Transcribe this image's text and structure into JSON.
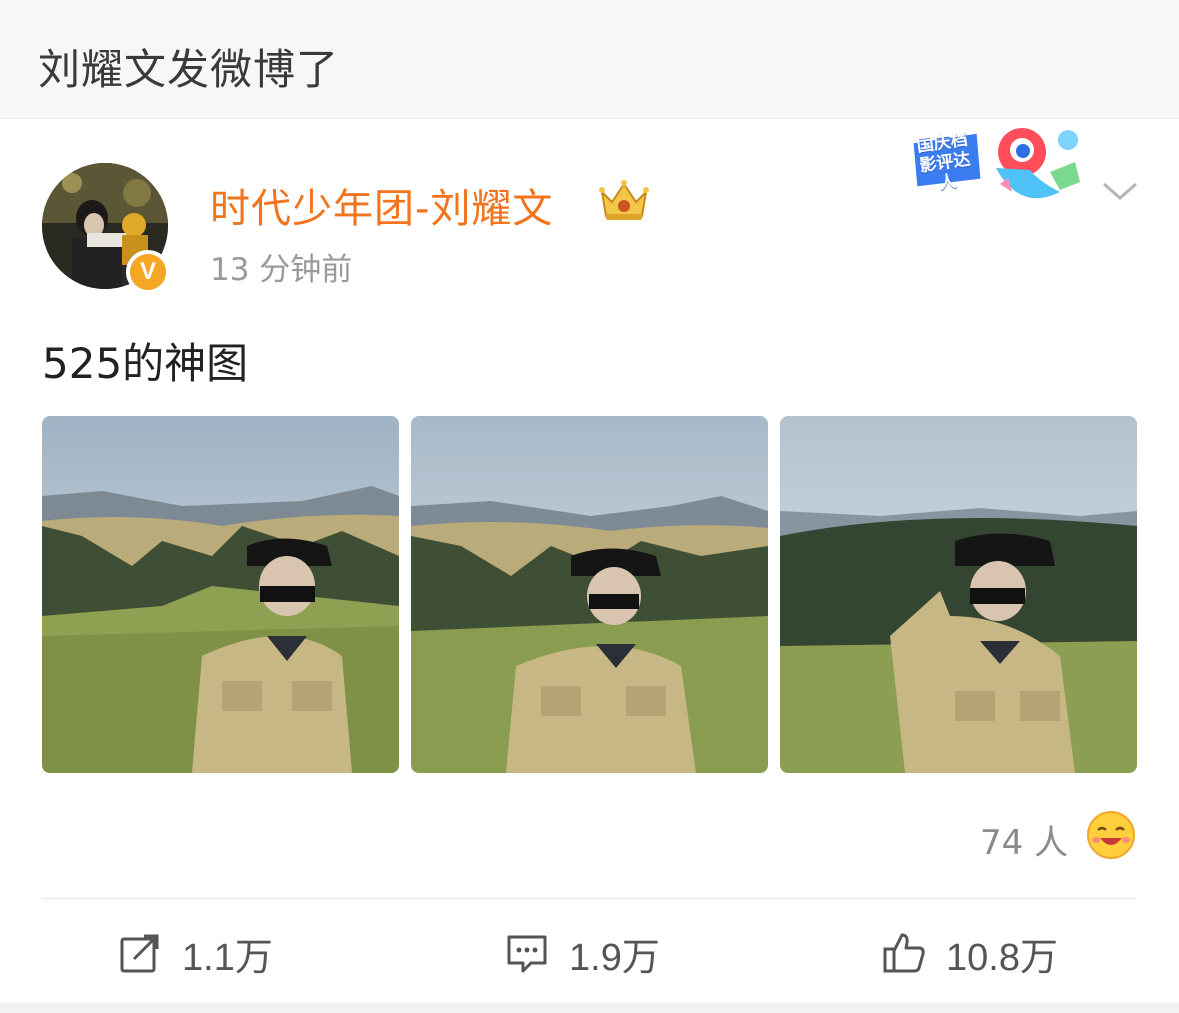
{
  "header": {
    "title": "刘耀文发微博了"
  },
  "post": {
    "author": "时代少年团-刘耀文",
    "verified_badge": "V",
    "time": "13 分钟前",
    "award_badge": "国庆档影评达人",
    "text": "525的神图",
    "photos": [
      "photo-1",
      "photo-2",
      "photo-3"
    ],
    "reactions": {
      "count": "74 人"
    },
    "actions": {
      "share": "1.1万",
      "comment": "1.9万",
      "like": "10.8万"
    }
  },
  "colors": {
    "author": "#f2741d",
    "verified": "#f5a623",
    "header_bg": "#f7f7f7"
  }
}
